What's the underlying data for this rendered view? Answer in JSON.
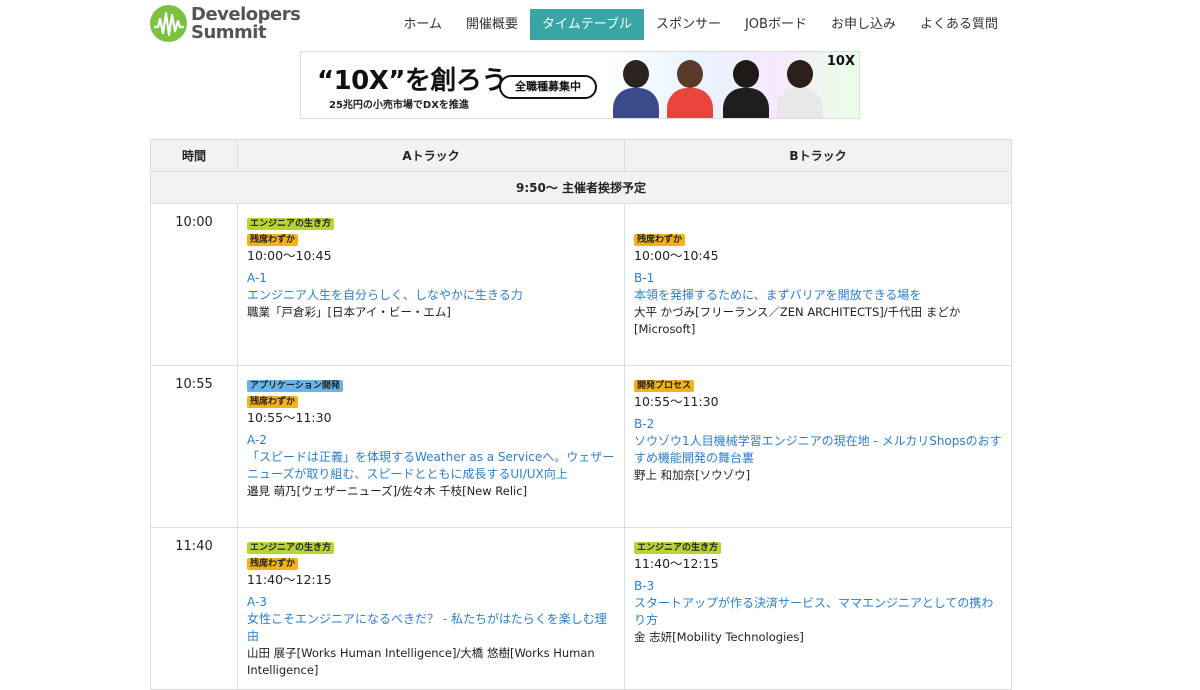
{
  "header": {
    "logo_line1": "Developers",
    "logo_line2": "Summit",
    "nav": [
      {
        "label": "ホーム",
        "active": false
      },
      {
        "label": "開催概要",
        "active": false
      },
      {
        "label": "タイムテーブル",
        "active": true
      },
      {
        "label": "スポンサー",
        "active": false
      },
      {
        "label": "JOBボード",
        "active": false
      },
      {
        "label": "お申し込み",
        "active": false
      },
      {
        "label": "よくある質問",
        "active": false
      }
    ]
  },
  "banner": {
    "headline": "“10X”を創ろう",
    "sub": "25兆円の小売市場でDXを推進",
    "pill": "全職種募集中",
    "brand": "10X"
  },
  "table": {
    "headers": {
      "time": "時間",
      "a": "Aトラック",
      "b": "Bトラック"
    },
    "notice": "9:50〜 主催者挨拶予定",
    "rows": [
      {
        "time": "10:00",
        "a": {
          "tags": [
            {
              "label": "エンジニアの生き方",
              "color": "green"
            },
            {
              "label": "残席わずか",
              "color": "orange"
            }
          ],
          "time": "10:00〜10:45",
          "code": "A-1",
          "title": "エンジニア人生を自分らしく、しなやかに生きる力",
          "speaker": "職業「戸倉彩」[日本アイ・ビー・エム]"
        },
        "b": {
          "tags": [
            {
              "label": "残席わずか",
              "color": "orange"
            }
          ],
          "time": "10:00〜10:45",
          "code": "B-1",
          "title": "本領を発揮するために、まずバリアを開放できる場を",
          "speaker": "大平 かづみ[フリーランス／ZEN ARCHITECTS]/千代田 まどか[Microsoft]"
        }
      },
      {
        "time": "10:55",
        "a": {
          "tags": [
            {
              "label": "アプリケーション開発",
              "color": "blue"
            },
            {
              "label": "残席わずか",
              "color": "orange"
            }
          ],
          "time": "10:55〜11:30",
          "code": "A-2",
          "title": "「スピードは正義」を体現するWeather as a Serviceへ。ウェザーニューズが取り組む、スピードとともに成長するUI/UX向上",
          "speaker": "邉見 萌乃[ウェザーニューズ]/佐々木 千枝[New Relic]"
        },
        "b": {
          "tags": [
            {
              "label": "開発プロセス",
              "color": "orange"
            }
          ],
          "time": "10:55〜11:30",
          "code": "B-2",
          "title": "ソウゾウ1人目機械学習エンジニアの現在地 - メルカリShopsのおすすめ機能開発の舞台裏",
          "speaker": "野上 和加奈[ソウゾウ]"
        }
      },
      {
        "time": "11:40",
        "a": {
          "tags": [
            {
              "label": "エンジニアの生き方",
              "color": "green"
            },
            {
              "label": "残席わずか",
              "color": "orange"
            }
          ],
          "time": "11:40〜12:15",
          "code": "A-3",
          "title": "女性こそエンジニアになるべきだ？ - 私たちがはたらくを楽しむ理由",
          "speaker": "山田 展子[Works Human Intelligence]/大橋 悠樹[Works Human Intelligence]"
        },
        "b": {
          "tags": [
            {
              "label": "エンジニアの生き方",
              "color": "green"
            }
          ],
          "time": "11:40〜12:15",
          "code": "B-3",
          "title": "スタートアップが作る決済サービス、ママエンジニアとしての携わり方",
          "speaker": "金 志妍[Mobility Technologies]"
        }
      }
    ]
  }
}
